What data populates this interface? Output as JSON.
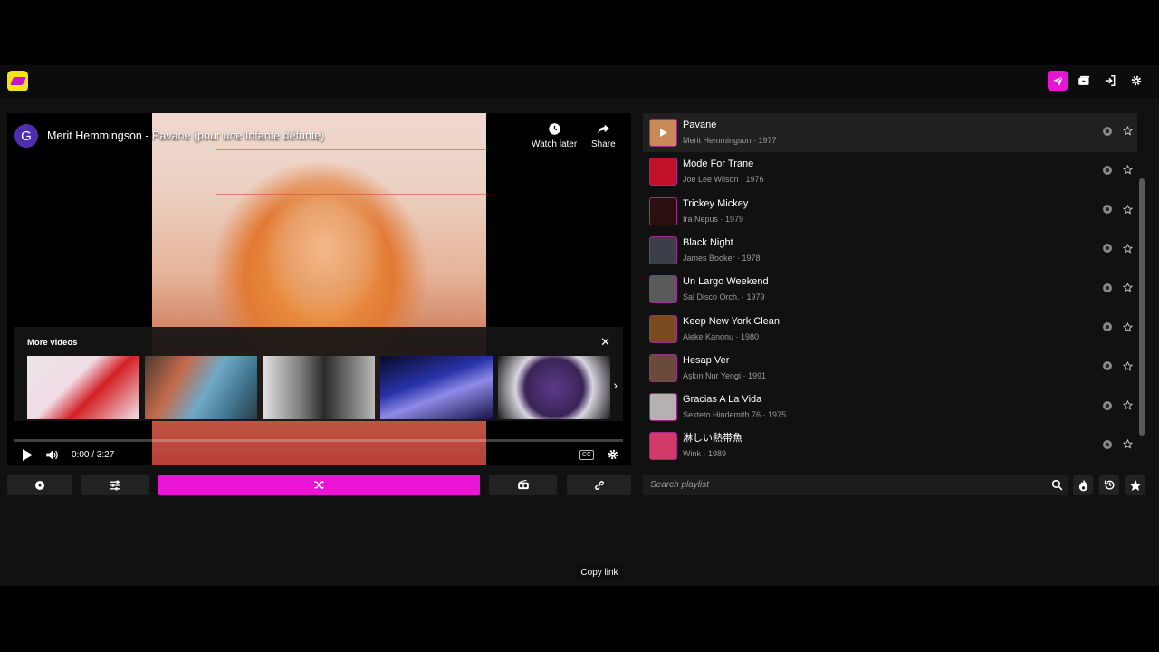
{
  "app": {
    "colors": {
      "accent": "#e815d6",
      "logo_bg": "#f5e11c",
      "bg": "#111111"
    }
  },
  "video": {
    "channel_initial": "G",
    "title": "Merit Hemmingson - Pavane (pour une Infante défunte)",
    "watch_later_label": "Watch later",
    "share_label": "Share",
    "more_videos_title": "More videos",
    "time": "0:00 / 3:27",
    "cc_label": "CC",
    "progress": 0.0
  },
  "tooltip": {
    "copy_link": "Copy link"
  },
  "playlist": {
    "search_placeholder": "Search playlist",
    "items": [
      {
        "title": "Pavane",
        "meta": "Merit Hemmingson · 1977",
        "art_color": "#c98a5a"
      },
      {
        "title": "Mode For Trane",
        "meta": "Joe Lee Wilson · 1976",
        "art_color": "#c0102a"
      },
      {
        "title": "Trickey Mickey",
        "meta": "Ira Nepus · 1979",
        "art_color": "#2a1010"
      },
      {
        "title": "Black Night",
        "meta": "James Booker · 1978",
        "art_color": "#3a3f4a"
      },
      {
        "title": "Un Largo Weekend",
        "meta": "Sal Disco Orch. · 1979",
        "art_color": "#5a5a5a"
      },
      {
        "title": "Keep New York Clean",
        "meta": "Aleke Kanonu · 1980",
        "art_color": "#7a4a20"
      },
      {
        "title": "Hesap Ver",
        "meta": "Aşkın Nur Yengi · 1991",
        "art_color": "#6a4a3a"
      },
      {
        "title": "Gracias A La Vida",
        "meta": "Sexteto Hindemith 76 · 1975",
        "art_color": "#b7b0b3"
      },
      {
        "title": "淋しい熱帯魚",
        "meta": "Wink · 1989",
        "art_color": "#d23a68"
      }
    ]
  }
}
